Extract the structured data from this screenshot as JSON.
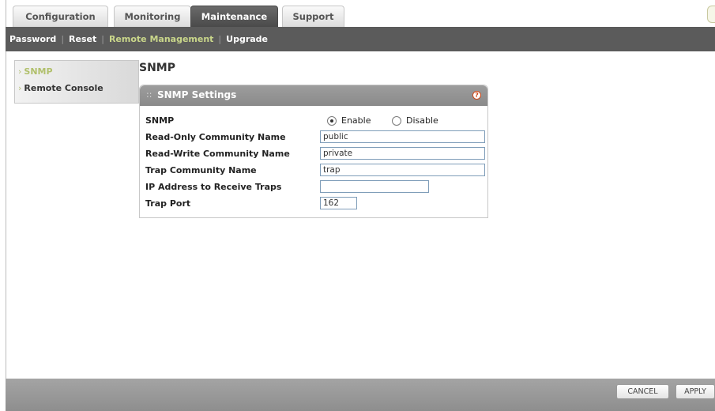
{
  "tabs": [
    {
      "label": "Configuration"
    },
    {
      "label": "Monitoring"
    },
    {
      "label": "Maintenance"
    },
    {
      "label": "Support"
    }
  ],
  "subnav": {
    "items": [
      "Password",
      "Reset",
      "Remote Management",
      "Upgrade"
    ],
    "current": "Remote Management"
  },
  "leftmenu": {
    "items": [
      {
        "label": "SNMP",
        "selected": true
      },
      {
        "label": "Remote Console",
        "selected": false
      }
    ]
  },
  "page": {
    "title": "SNMP"
  },
  "panel": {
    "title": "SNMP Settings",
    "help_icon": "?",
    "snmp_label": "SNMP",
    "radio": {
      "enable_label": "Enable",
      "disable_label": "Disable",
      "selected": "Enable"
    },
    "fields": [
      {
        "label": "Read-Only Community Name",
        "value": "public"
      },
      {
        "label": "Read-Write Community Name",
        "value": "private"
      },
      {
        "label": "Trap Community Name",
        "value": "trap"
      },
      {
        "label": "IP Address to Receive Traps",
        "value": ""
      },
      {
        "label": "Trap Port",
        "value": "162"
      }
    ]
  },
  "buttons": {
    "cancel": "CANCEL",
    "apply": "APPLY"
  },
  "colors": {
    "nav_bg": "#5b5b5b",
    "current_link": "#c9d68a",
    "panel_header": "#959595",
    "help_icon": "#d04a1a"
  }
}
